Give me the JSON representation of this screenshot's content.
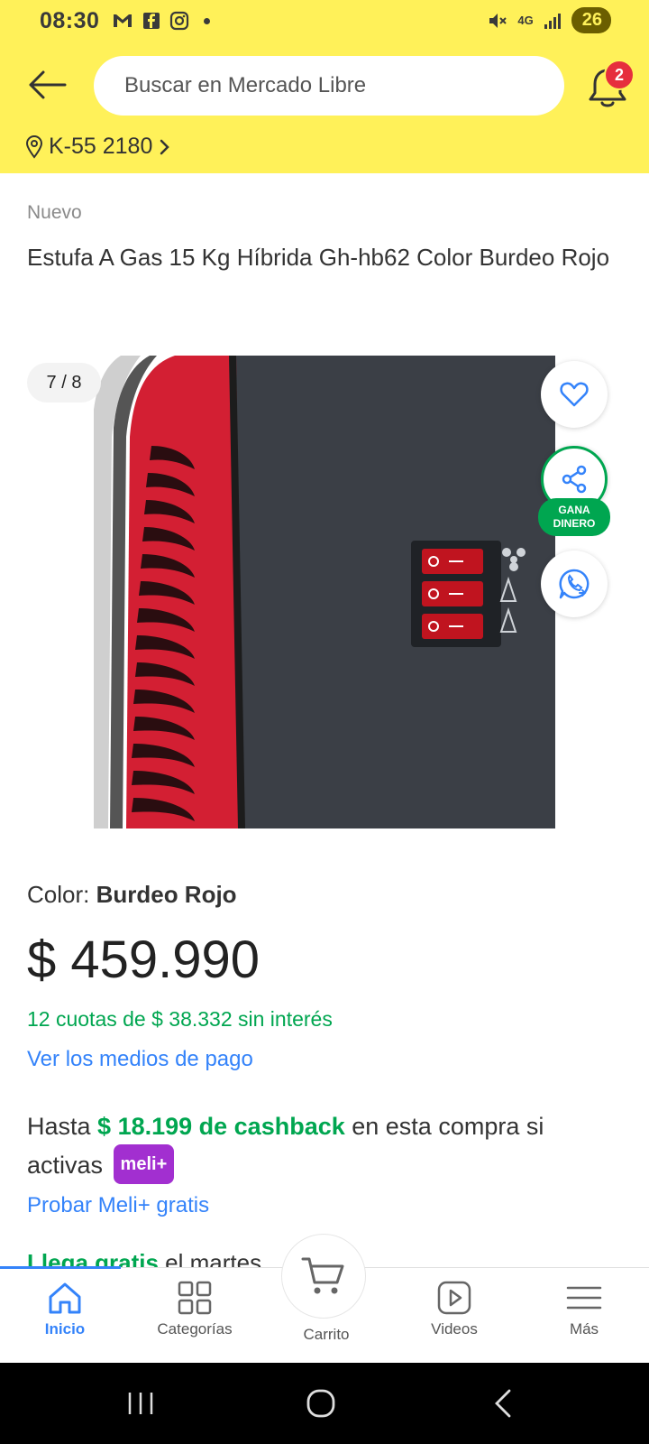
{
  "status_bar": {
    "time": "08:30",
    "network": "4G",
    "battery": "26"
  },
  "header": {
    "search_placeholder": "Buscar en Mercado Libre",
    "notification_count": "2",
    "location": "K-55 2180"
  },
  "product": {
    "condition": "Nuevo",
    "title": "Estufa A Gas 15 Kg Híbrida Gh-hb62 Color Burdeo Rojo",
    "gallery_counter": "7 / 8",
    "earn_badge_line1": "GANA",
    "earn_badge_line2": "DINERO",
    "color_label": "Color: ",
    "color_value": "Burdeo Rojo",
    "price": "$ 459.990",
    "installments": "12 cuotas de $ 38.332 sin interés",
    "payment_link": "Ver los medios de pago",
    "cashback_prefix": "Hasta ",
    "cashback_amount": "$ 18.199 de cashback",
    "cashback_suffix": " en esta compra si activas ",
    "meli_badge": "meli+",
    "meli_link": "Probar Meli+ gratis",
    "shipping_free": "Llega gratis",
    "shipping_rest": " el martes"
  },
  "bottom_nav": {
    "items": [
      {
        "label": "Inicio",
        "icon": "home-icon"
      },
      {
        "label": "Categorías",
        "icon": "grid-icon"
      },
      {
        "label": "Carrito",
        "icon": "cart-icon"
      },
      {
        "label": "Videos",
        "icon": "play-icon"
      },
      {
        "label": "Más",
        "icon": "menu-icon"
      }
    ]
  },
  "colors": {
    "brand_yellow": "#fff159",
    "link_blue": "#3483fa",
    "green": "#00a650",
    "meli_purple": "#a22fd0",
    "badge_red": "#e62e3d"
  }
}
